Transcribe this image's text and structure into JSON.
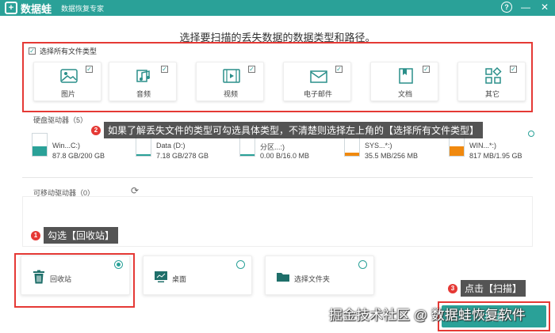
{
  "app": {
    "name": "数据蛙",
    "subtitle": "数据恢复专家",
    "logo_mark": "+"
  },
  "window": {
    "help": "?",
    "minimize": "—",
    "close": "✕"
  },
  "heading": "选择要扫描的丢失数据的数据类型和路径。",
  "select_all": {
    "label": "选择所有文件类型",
    "checked": true
  },
  "file_types": [
    {
      "label": "图片",
      "icon": "image-icon",
      "checked": true
    },
    {
      "label": "音频",
      "icon": "audio-icon",
      "checked": true
    },
    {
      "label": "视频",
      "icon": "video-icon",
      "checked": true
    },
    {
      "label": "电子邮件",
      "icon": "email-icon",
      "checked": true
    },
    {
      "label": "文档",
      "icon": "document-icon",
      "checked": true
    },
    {
      "label": "其它",
      "icon": "other-icon",
      "checked": true
    }
  ],
  "hard_drives": {
    "label": "硬盘驱动器（5）",
    "drives": [
      {
        "name": "Win...C:)",
        "size": "87.8 GB/200 GB",
        "fill_color": "#2aa198",
        "fill": 0.44
      },
      {
        "name": "Data (D:)",
        "size": "7.18 GB/278 GB",
        "fill_color": "#2aa198",
        "fill": 0.05
      },
      {
        "name": "分区...:)",
        "size": "0.00  B/16.0 MB",
        "fill_color": "#2aa198",
        "fill": 0.02
      },
      {
        "name": "SYS...*:)",
        "size": "35.5 MB/256 MB",
        "fill_color": "#f0890f",
        "fill": 0.14
      },
      {
        "name": "WIN...*:)",
        "size": "817 MB/1.95 GB",
        "fill_color": "#f0890f",
        "fill": 0.42
      }
    ]
  },
  "removable": {
    "label": "可移动驱动器（0）"
  },
  "locations": [
    {
      "label": "回收站",
      "icon": "trash-icon",
      "selected": true
    },
    {
      "label": "桌面",
      "icon": "desktop-icon",
      "selected": false
    },
    {
      "label": "选择文件夹",
      "icon": "folder-icon",
      "selected": false
    }
  ],
  "scan_button": "扫描",
  "annotations": [
    {
      "num": "1",
      "text": "勾选【回收站】"
    },
    {
      "num": "2",
      "text": "如果了解丢失文件的类型可勾选具体类型，不清楚则选择左上角的【选择所有文件类型】"
    },
    {
      "num": "3",
      "text": "点击【扫描】"
    }
  ],
  "watermark": "掘金技术社区 @ 数据蛙恢复软件",
  "colors": {
    "accent": "#2aa198",
    "highlight": "#e53935",
    "warning": "#f0890f"
  }
}
